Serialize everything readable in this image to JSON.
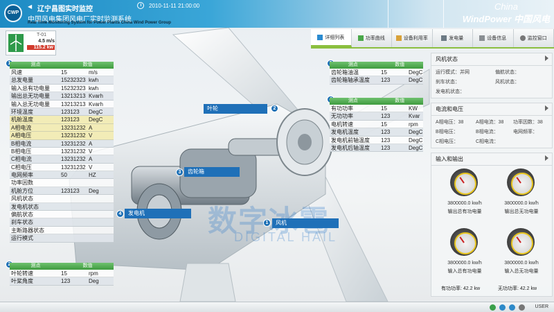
{
  "header": {
    "logo": "CWP",
    "site_title": "辽宁昌图实时监控",
    "datetime": "2010-11-11  21:00:00",
    "system_title_cn": "中国风电集团风电厂实时监测系统",
    "system_title_en": "Real Time Monitoring System for Power Plants China Wind Power Group",
    "brand_line1": "China",
    "brand_line2": "WindPower 中国风电"
  },
  "turbine": {
    "id": "T-01",
    "wind_speed": "4.5 m/s",
    "power": "115.2 kw"
  },
  "table1": {
    "badge": "1",
    "headers": [
      "测点",
      "数值"
    ],
    "rows": [
      {
        "name": "风速",
        "value": "15",
        "unit": "m/s"
      },
      {
        "name": "总发电量",
        "value": "15232323",
        "unit": "kwh"
      },
      {
        "name": "输入总有功电量",
        "value": "15232323",
        "unit": "kwh"
      },
      {
        "name": "输出总无功电量",
        "value": "13213213",
        "unit": "Kvarh"
      },
      {
        "name": "输入总无功电量",
        "value": "13213213",
        "unit": "Kvarh"
      },
      {
        "name": "环境温度",
        "value": "123123",
        "unit": "DegC"
      },
      {
        "name": "机舱温度",
        "value": "123123",
        "unit": "DegC"
      },
      {
        "name": "A相电流",
        "value": "13231232",
        "unit": "A"
      },
      {
        "name": "A相电压",
        "value": "13231232",
        "unit": "V"
      },
      {
        "name": "B相电流",
        "value": "13231232",
        "unit": "A"
      },
      {
        "name": "B相电压",
        "value": "13231232",
        "unit": "V"
      },
      {
        "name": "C相电流",
        "value": "13231232",
        "unit": "A"
      },
      {
        "name": "C相电压",
        "value": "13231232",
        "unit": "V"
      },
      {
        "name": "电网频率",
        "value": "50",
        "unit": "HZ"
      },
      {
        "name": "功率因数",
        "value": "",
        "unit": ""
      },
      {
        "name": "机舱方位",
        "value": "123123",
        "unit": "Deg"
      },
      {
        "name": "风机状态",
        "value": "",
        "unit": ""
      },
      {
        "name": "发电机状态",
        "value": "",
        "unit": ""
      },
      {
        "name": "偏航状态",
        "value": "",
        "unit": ""
      },
      {
        "name": "刹车状态",
        "value": "",
        "unit": ""
      },
      {
        "name": "主断路器状态",
        "value": "",
        "unit": ""
      },
      {
        "name": "运行模式",
        "value": "",
        "unit": ""
      }
    ]
  },
  "table2": {
    "badge": "2",
    "headers": [
      "测点",
      "数值"
    ],
    "rows": [
      {
        "name": "叶轮转速",
        "value": "15",
        "unit": "rpm"
      },
      {
        "name": "叶桨角度",
        "value": "123",
        "unit": "Deg"
      }
    ]
  },
  "table3": {
    "badge": "3",
    "headers": [
      "测点",
      "数值"
    ],
    "rows": [
      {
        "name": "齿轮箱油温",
        "value": "15",
        "unit": "DegC"
      },
      {
        "name": "齿轮箱轴承温度",
        "value": "123",
        "unit": "DegC"
      }
    ]
  },
  "table4": {
    "badge": "4",
    "headers": [
      "测点",
      "数值"
    ],
    "rows": [
      {
        "name": "有功功率",
        "value": "15",
        "unit": "KW"
      },
      {
        "name": "无功功率",
        "value": "123",
        "unit": "Kvar"
      },
      {
        "name": "电机转速",
        "value": "15",
        "unit": "rpm"
      },
      {
        "name": "发电机温度",
        "value": "123",
        "unit": "DegC"
      },
      {
        "name": "发电机前轴温度",
        "value": "123",
        "unit": "DegC"
      },
      {
        "name": "发电机后轴温度",
        "value": "123",
        "unit": "DegC"
      }
    ]
  },
  "callouts": {
    "rotor": {
      "badge": "2",
      "label": "叶轮"
    },
    "gearbox": {
      "badge": "3",
      "label": "齿轮箱"
    },
    "generator": {
      "badge": "4",
      "label": "发电机"
    },
    "nacelle": {
      "badge": "1",
      "label": "风机"
    }
  },
  "toolbar": {
    "items": [
      "详细列表",
      "功率曲线",
      "设备利用率",
      "发电量",
      "设备信息",
      "监控窗口"
    ]
  },
  "panel_status": {
    "title": "风机状态",
    "fields": [
      "运行模式：并网",
      "偏航状态：",
      "刹车状态：",
      "风机状态：",
      "发电机状态："
    ]
  },
  "panel_electric": {
    "title": "电流和电压",
    "fields": [
      "A相电压：38",
      "A相电流：38",
      "功率因数：38",
      "B相电压：",
      "B相电流：",
      "电网频率：",
      "C相电压：",
      "C相电流："
    ]
  },
  "panel_io": {
    "title": "输入和输出",
    "gauges": [
      {
        "value": "3800000.0 kw/h",
        "label": "输出总有功电量"
      },
      {
        "value": "3800000.0 kw/h",
        "label": "输出总无功电量"
      },
      {
        "value": "3800000.0 kw/h",
        "label": "输入总有功电量"
      },
      {
        "value": "3800000.0 kw/h",
        "label": "输入总无功电量"
      }
    ],
    "active_power": "有功功率: 42.2 kw",
    "reactive_power": "无功功率: 42.2 kw"
  },
  "footer": {
    "user": "USER"
  },
  "watermark": {
    "cn": "数字冰雹",
    "en": "DIGITAL HAIL"
  },
  "colors": {
    "header_blue": "#1d8bc4",
    "table_green": "#4aa84a",
    "callout_blue": "#1f70b8",
    "power_red": "#d23b2d",
    "accent_green": "#8bbf3f"
  }
}
